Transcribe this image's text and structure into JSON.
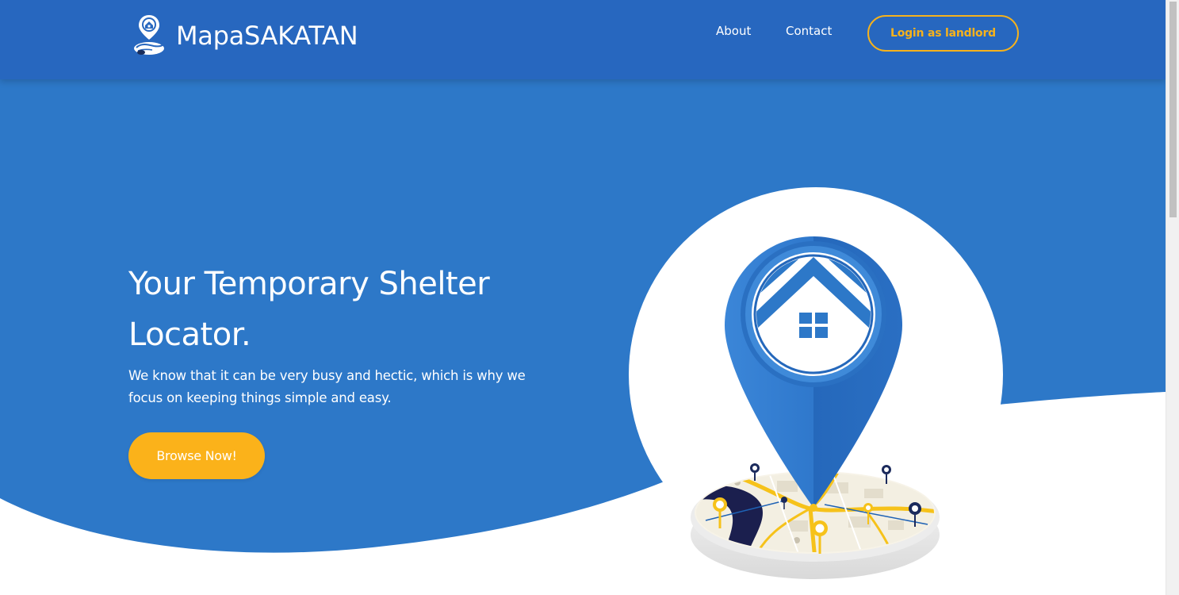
{
  "brand": {
    "name": "MapaSAKATAN",
    "logo_icon": "house-pin-hand-icon"
  },
  "nav": {
    "about": "About",
    "contact": "Contact",
    "login": "Login as landlord"
  },
  "hero": {
    "title_line1": "Your Temporary Shelter",
    "title_line2": "Locator.",
    "subtitle": "We know that it can be very busy and hectic, which is why we focus on keeping things simple and easy.",
    "cta": "Browse Now!",
    "illustration_icon": "map-location-pin-house-icon"
  },
  "colors": {
    "header": "#2767bf",
    "hero_bg": "#2d78c8",
    "accent": "#fbb21a",
    "white": "#ffffff"
  }
}
